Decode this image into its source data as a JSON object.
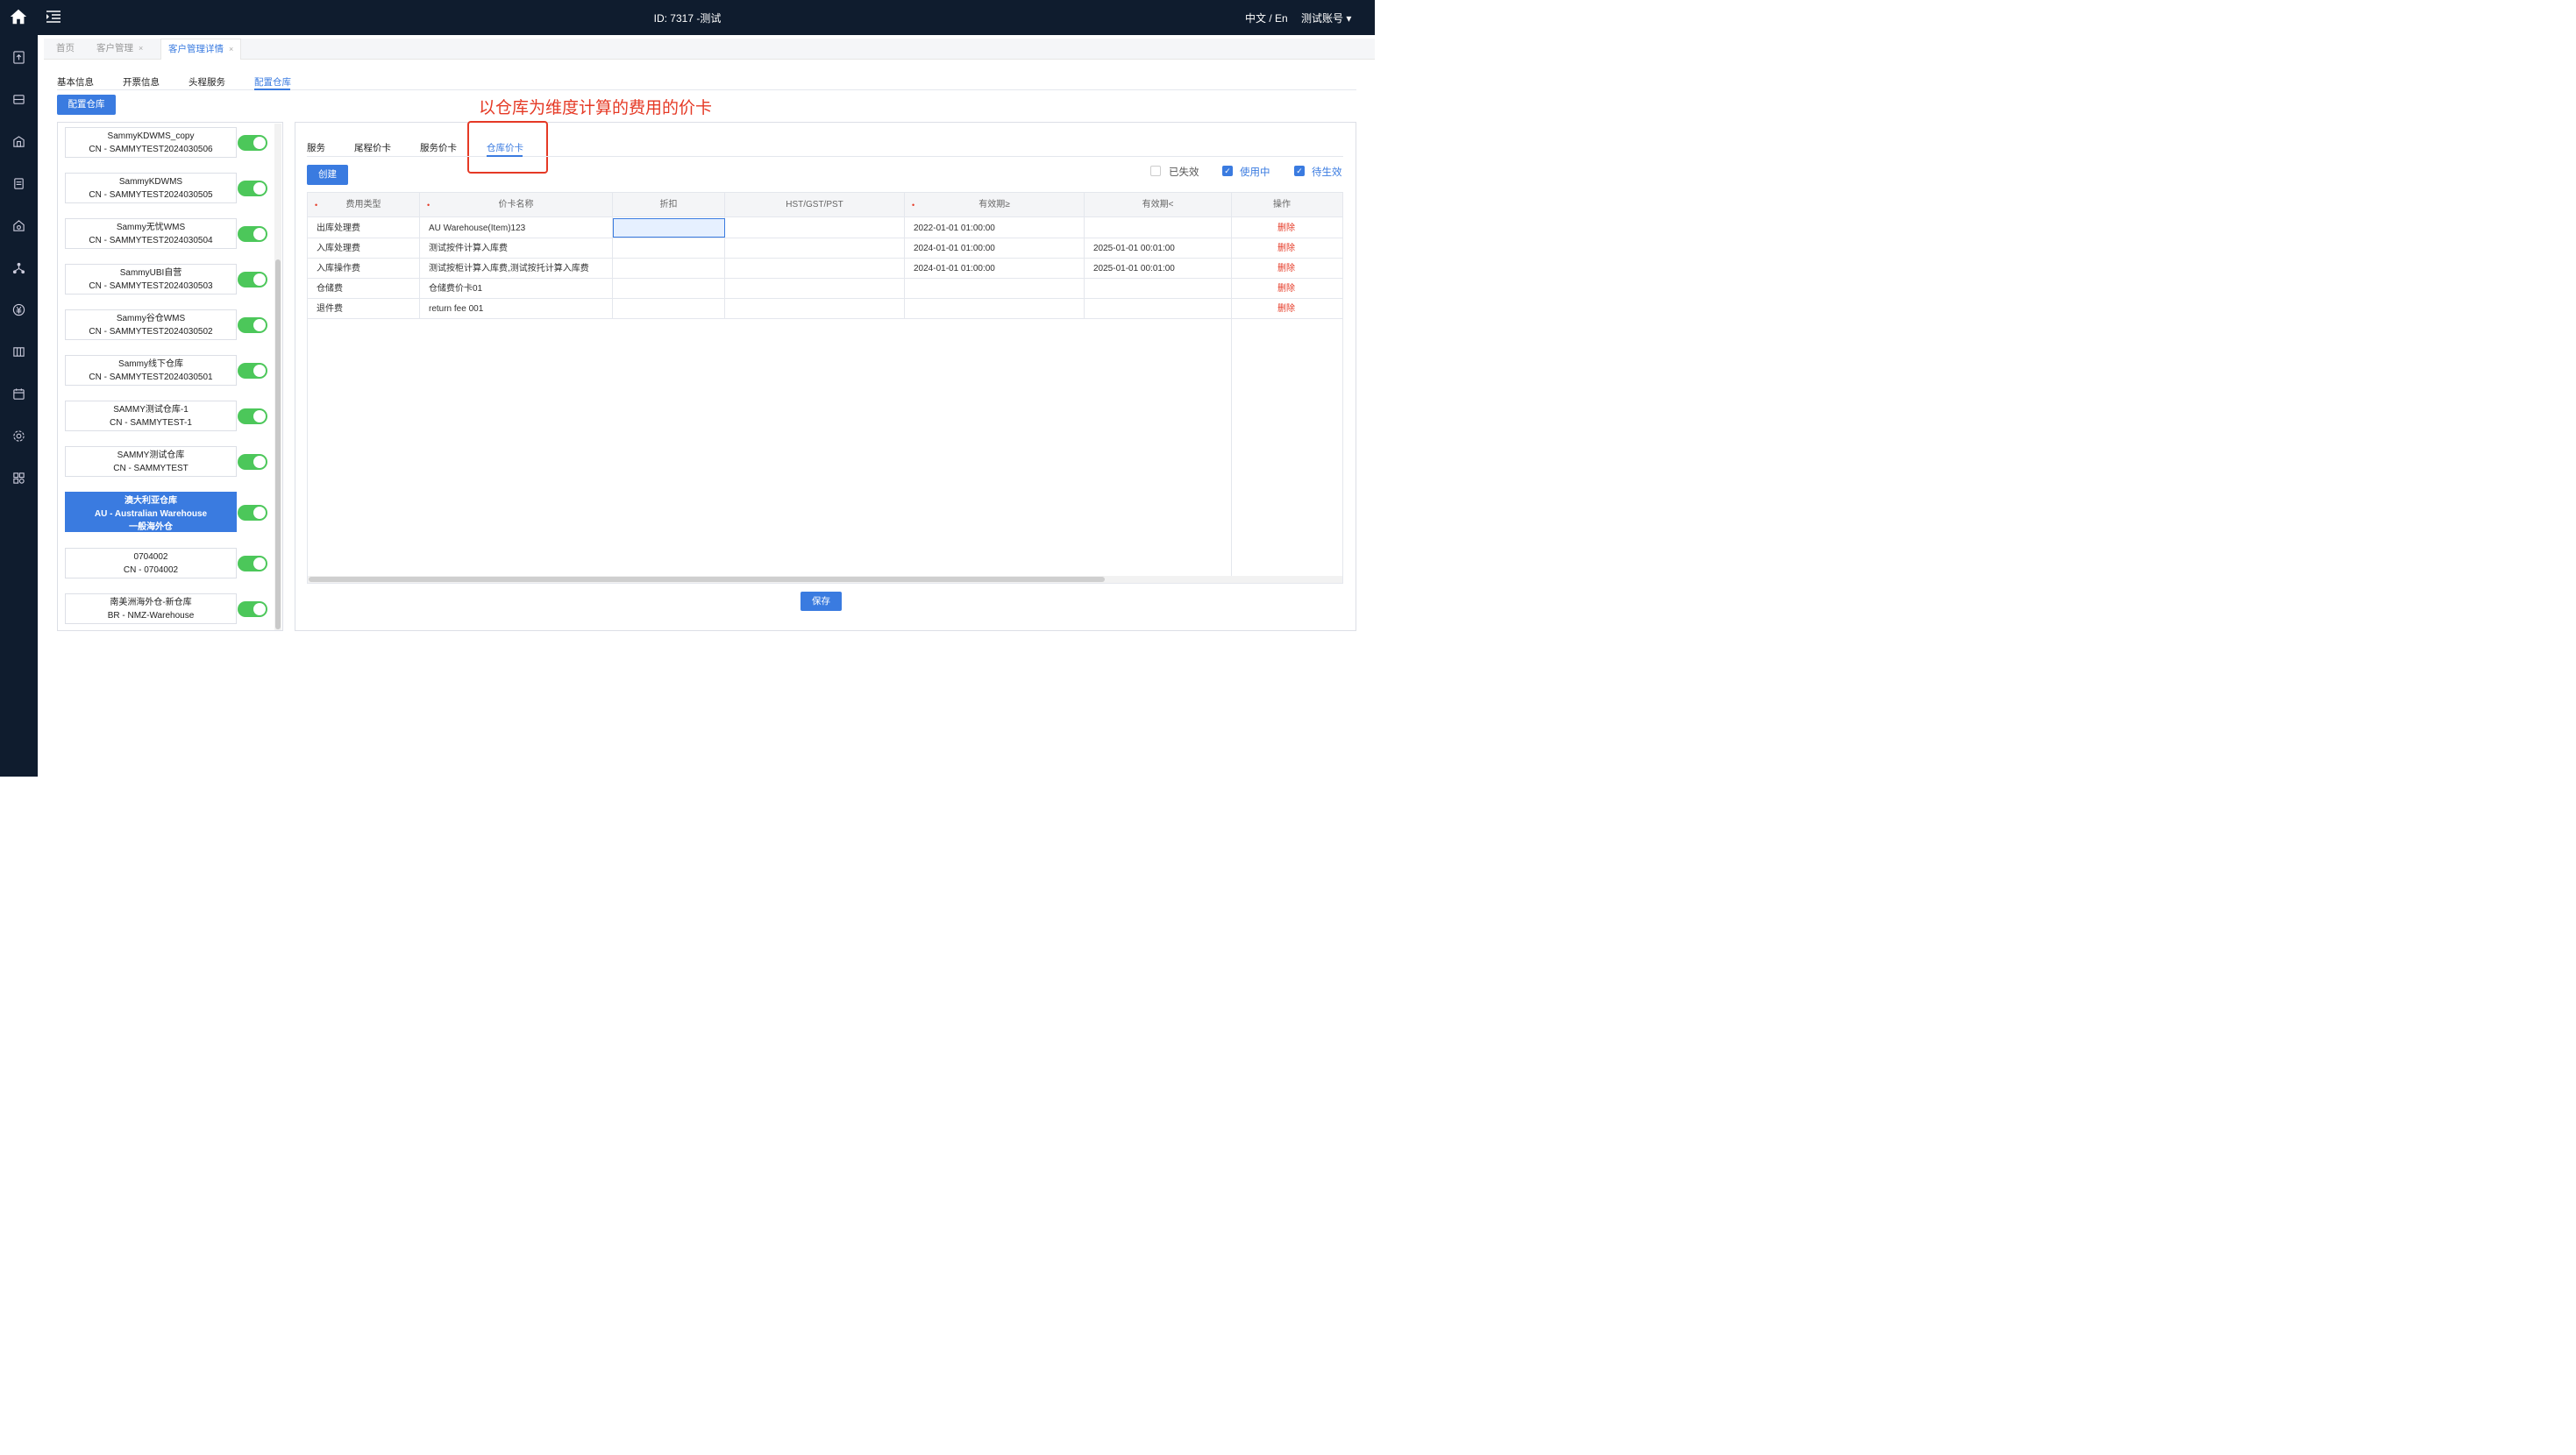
{
  "header": {
    "title": "ID: 7317 -测试",
    "lang": "中文 / En",
    "account": "测试账号 ▾"
  },
  "breadcrumbs": [
    {
      "label": "首页"
    },
    {
      "label": "客户管理",
      "close": "×"
    },
    {
      "label": "客户管理详情",
      "close": "×"
    }
  ],
  "page_tabs": [
    "基本信息",
    "开票信息",
    "头程服务",
    "配置仓库"
  ],
  "config_button": "配置仓库",
  "annotation": "以仓库为维度计算的费用的价卡",
  "warehouses": [
    {
      "line1": "SammyKDWMS_copy",
      "line2": "CN - SAMMYTEST2024030506"
    },
    {
      "line1": "SammyKDWMS",
      "line2": "CN - SAMMYTEST2024030505"
    },
    {
      "line1": "Sammy无忧WMS",
      "line2": "CN - SAMMYTEST2024030504"
    },
    {
      "line1": "SammyUBI自营",
      "line2": "CN - SAMMYTEST2024030503"
    },
    {
      "line1": "Sammy谷仓WMS",
      "line2": "CN - SAMMYTEST2024030502"
    },
    {
      "line1": "Sammy线下仓库",
      "line2": "CN - SAMMYTEST2024030501"
    },
    {
      "line1": "SAMMY测试仓库-1",
      "line2": "CN - SAMMYTEST-1"
    },
    {
      "line1": "SAMMY测试仓库",
      "line2": "CN - SAMMYTEST"
    },
    {
      "line1": "澳大利亚仓库",
      "line2": "AU - Australian Warehouse",
      "line3": "一般海外仓"
    },
    {
      "line1": "0704002",
      "line2": "CN - 0704002"
    },
    {
      "line1": "南美洲海外仓-新仓库",
      "line2": "BR - NMZ-Warehouse"
    }
  ],
  "sub_tabs": [
    "服务",
    "尾程价卡",
    "服务价卡",
    "仓库价卡"
  ],
  "create_button": "创建",
  "filters": [
    {
      "label": "已失效",
      "checked": false
    },
    {
      "label": "使用中",
      "checked": true
    },
    {
      "label": "待生效",
      "checked": true
    }
  ],
  "table": {
    "req_mark": "•",
    "columns": [
      "费用类型",
      "价卡名称",
      "折扣",
      "HST/GST/PST",
      "有效期≥",
      "有效期<",
      "操作"
    ],
    "rows": [
      {
        "type": "出库处理费",
        "name": "AU Warehouse(Item)123",
        "discount": "",
        "tax": "",
        "from": "2022-01-01 01:00:00",
        "to": "",
        "action": "删除"
      },
      {
        "type": "入库处理费",
        "name": "测试按件计算入库费",
        "discount": "",
        "tax": "",
        "from": "2024-01-01 01:00:00",
        "to": "2025-01-01 00:01:00",
        "action": "删除"
      },
      {
        "type": "入库操作费",
        "name": "测试按柜计算入库费,测试按托计算入库费",
        "discount": "",
        "tax": "",
        "from": "2024-01-01 01:00:00",
        "to": "2025-01-01 00:01:00",
        "action": "删除"
      },
      {
        "type": "仓储费",
        "name": "仓储费价卡01",
        "discount": "",
        "tax": "",
        "from": "",
        "to": "",
        "action": "删除"
      },
      {
        "type": "退件费",
        "name": "return fee 001",
        "discount": "",
        "tax": "",
        "from": "",
        "to": "",
        "action": "删除"
      }
    ]
  },
  "save_button": "保存",
  "colors": {
    "primary": "#3a7be0",
    "topbar": "#0f1c2e",
    "toggle_on": "#4cc75a",
    "danger": "#e53925"
  }
}
